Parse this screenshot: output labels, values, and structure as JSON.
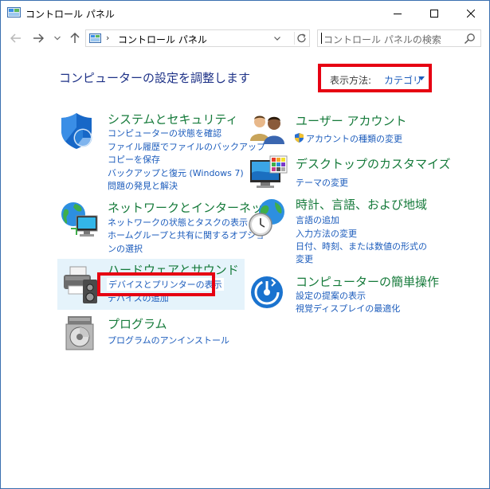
{
  "window": {
    "title": "コントロール パネル",
    "controls": {
      "minimize": "minimize-icon",
      "maximize": "maximize-icon",
      "close": "close-icon"
    }
  },
  "nav": {
    "back_icon": "arrow-left-icon",
    "forward_icon": "arrow-right-icon",
    "recent_icon": "chevron-down-icon",
    "up_icon": "arrow-up-icon",
    "address": {
      "separator": "›",
      "path": "コントロール パネル",
      "trail": "›"
    },
    "refresh_icon": "refresh-icon",
    "search": {
      "placeholder": "コントロール パネルの検索"
    }
  },
  "content": {
    "heading": "コンピューターの設定を調整します",
    "view_by": {
      "label": "表示方法:",
      "value": "カテゴリ"
    },
    "categories": [
      {
        "title": "システムとセキュリティ",
        "icon": "shield-icon",
        "links": [
          "コンピューターの状態を確認",
          "ファイル履歴でファイルのバックアップ",
          "コピーを保存",
          "バックアップと復元 (Windows 7)",
          "問題の発見と解決"
        ]
      },
      {
        "title": "ネットワークとインターネット",
        "icon": "network-globe-icon",
        "links": [
          "ネットワークの状態とタスクの表示",
          "ホームグループと共有に関するオプショ",
          "ンの選択"
        ]
      },
      {
        "title": "ハードウェアとサウンド",
        "icon": "printer-speaker-icon",
        "links": [
          "デバイスとプリンターの表示",
          "デバイスの追加"
        ]
      },
      {
        "title": "プログラム",
        "icon": "programs-disc-icon",
        "links": [
          "プログラムのアンインストール"
        ]
      },
      {
        "title": "ユーザー アカウント",
        "icon": "users-icon",
        "links": [
          "アカウントの種類の変更"
        ]
      },
      {
        "title": "デスクトップのカスタマイズ",
        "icon": "monitor-colors-icon",
        "links": [
          "テーマの変更"
        ]
      },
      {
        "title": "時計、言語、および地域",
        "icon": "clock-globe-icon",
        "links": [
          "言語の追加",
          "入力方法の変更",
          "日付、時刻、または数値の形式の",
          "変更"
        ]
      },
      {
        "title": "コンピューターの簡単操作",
        "icon": "ease-of-access-icon",
        "links": [
          "設定の提案の表示",
          "視覚ディスプレイの最適化"
        ]
      }
    ]
  },
  "colors": {
    "category_title": "#157a3a",
    "link": "#1c5cbc",
    "heading": "#1e3287",
    "annotation": "#e60012",
    "hover_bg": "#e5f3fb"
  }
}
